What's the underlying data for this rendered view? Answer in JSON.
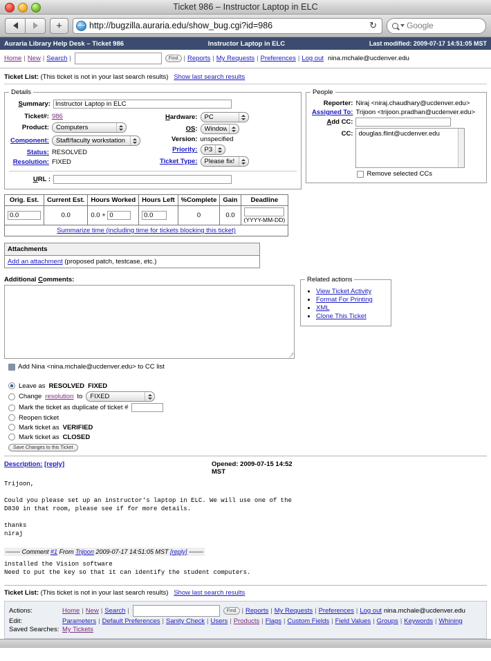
{
  "window": {
    "title": "Ticket 986 – Instructor Laptop in ELC",
    "url": "http://bugzilla.auraria.edu/show_bug.cgi?id=986",
    "search_placeholder": "Google",
    "reload_icon": "reload-icon",
    "back_icon": "back-arrow-icon",
    "forward_icon": "forward-arrow-icon",
    "add_tab_label": "+"
  },
  "header": {
    "site_title": "Auraria Library Help Desk – Ticket 986",
    "ticket_summary": "Instructor Laptop in ELC",
    "last_modified": "Last modified: 2009-07-17 14:51:05 MST"
  },
  "nav": {
    "home": "Home",
    "new": "New",
    "search": "Search",
    "quick_search_value": "",
    "find_button": "Find",
    "reports": "Reports",
    "my_requests": "My Requests",
    "preferences": "Preferences",
    "logout": "Log out",
    "user": "nina.mchale@ucdenver.edu",
    "separator": "|"
  },
  "ticket_list": {
    "label": "Ticket List:",
    "text": "(This ticket is not in your last search results)",
    "show_last": "Show last search results"
  },
  "details": {
    "legend": "Details",
    "summary_label": "Summary:",
    "summary_value": "Instructor Laptop in ELC",
    "ticket_num_label": "Ticket#:",
    "ticket_num": "986",
    "product_label": "Product:",
    "product": "Computers",
    "component_label": "Component:",
    "component": "Staff/faculty workstation",
    "status_label": "Status:",
    "status": "RESOLVED",
    "resolution_label": "Resolution:",
    "resolution": "FIXED",
    "hardware_label": "Hardware:",
    "hardware": "PC",
    "os_label": "OS:",
    "os": "Windows",
    "version_label": "Version:",
    "version": "unspecified",
    "priority_label": "Priority:",
    "priority": "P3",
    "ticket_type_label": "Ticket Type:",
    "ticket_type": "Please fix!",
    "url_label": "URL :",
    "url_value": ""
  },
  "people": {
    "legend": "People",
    "reporter_label": "Reporter:",
    "reporter": "Niraj <niraj.chaudhary@ucdenver.edu>",
    "assigned_label": "Assigned To:",
    "assigned": "Trijoon <trijoon.pradhan@ucdenver.edu>",
    "add_cc_label": "Add CC:",
    "add_cc_value": "",
    "cc_label": "CC:",
    "cc_list": [
      "douglas.flint@ucdenver.edu"
    ],
    "remove_cc_label": "Remove selected CCs"
  },
  "time_tracking": {
    "headers": [
      "Orig. Est.",
      "Current Est.",
      "Hours Worked",
      "Hours Left",
      "%Complete",
      "Gain",
      "Deadline"
    ],
    "orig_est": "0.0",
    "current_est": "0.0",
    "hours_worked_base": "0.0 +",
    "hours_worked_add": "0",
    "hours_left": "0.0",
    "percent_complete": "0",
    "gain": "0.0",
    "deadline": "",
    "deadline_hint": "(YYYY-MM-DD)",
    "summarize_link": "Summarize time (including time for tickets blocking this ticket)"
  },
  "attachments": {
    "header": "Attachments",
    "add_link": "Add an attachment",
    "add_note": "(proposed patch, testcase, etc.)"
  },
  "additional_comments": {
    "label": "Additional Comments:",
    "value": ""
  },
  "related_actions": {
    "legend": "Related actions",
    "items": [
      "View Ticket Activity",
      "Format For Printing",
      "XML",
      "Clone This Ticket"
    ]
  },
  "add_cc_self": {
    "label": "Add Nina <nina.mchale@ucdenver.edu> to CC list",
    "checked": true
  },
  "status_options": {
    "leave_prefix": "Leave as",
    "leave_status": "RESOLVED",
    "leave_resolution": "FIXED",
    "change_prefix": "Change",
    "change_link": "resolution",
    "change_to": "to",
    "change_value": "FIXED",
    "duplicate_label": "Mark the ticket as duplicate of ticket #",
    "duplicate_value": "",
    "reopen_label": "Reopen ticket",
    "verified_prefix": "Mark ticket as",
    "verified_status": "VERIFIED",
    "closed_prefix": "Mark ticket as",
    "closed_status": "CLOSED",
    "save_button": "Save Changes to this Ticket",
    "selected": "leave"
  },
  "description": {
    "label": "Description:",
    "reply": "[reply]",
    "opened_label": "Opened:",
    "opened_time": "2009-07-15 14:52",
    "opened_tz": "MST",
    "body": "Trijoon,\n\nCould you please set up an instructor's laptop in ELC. We will use one of the\nD830 in that room, please see if for more details.\n\nthanks\nniraj"
  },
  "comment1": {
    "dashes_left": "-------",
    "comment_label": "Comment",
    "comment_num": "#1",
    "from_label": "From",
    "author": "Trijoon",
    "timestamp": "2009-07-17 14:51:05 MST",
    "reply": "[reply]",
    "dashes_right": "-------",
    "body": "installed the Vision software\nNeed to put the key so that it can identify the student computers."
  },
  "bottom_ticket_list": {
    "label": "Ticket List:",
    "text": "(This ticket is not in your last search results)",
    "show_last": "Show last search results"
  },
  "footer": {
    "actions_label": "Actions:",
    "edit_label": "Edit:",
    "saved_label": "Saved Searches:",
    "actions": [
      "Home",
      "New",
      "Search"
    ],
    "find_button": "Find",
    "quick_search_value": "",
    "actions_after": [
      "Reports",
      "My Requests",
      "Preferences",
      "Log out"
    ],
    "user": "nina.mchale@ucdenver.edu",
    "edit_links": [
      "Parameters",
      "Default Preferences",
      "Sanity Check",
      "Users",
      "Products",
      "Flags",
      "Custom Fields",
      "Field Values",
      "Groups",
      "Keywords",
      "Whining"
    ],
    "saved_searches": [
      "My Tickets"
    ],
    "separator": "|"
  },
  "colors": {
    "header_bar": "#3c4c70",
    "link": "#1a1ac0",
    "visited_link": "#7d2a7d",
    "footer_bg": "#eceff3"
  }
}
